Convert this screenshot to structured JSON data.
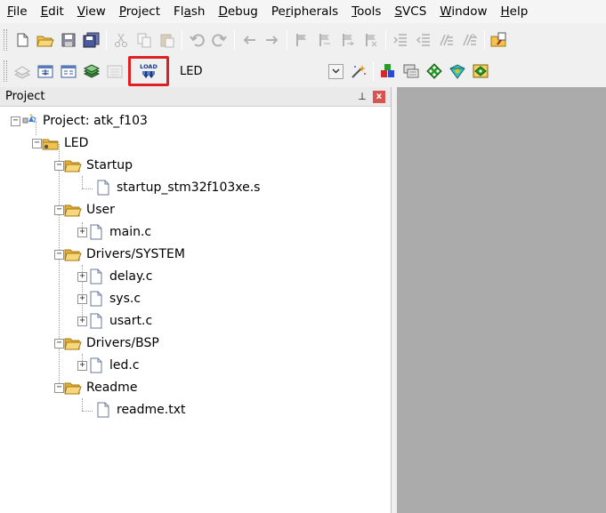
{
  "menu": {
    "items": [
      {
        "pre": "",
        "ul": "F",
        "post": "ile"
      },
      {
        "pre": "",
        "ul": "E",
        "post": "dit"
      },
      {
        "pre": "",
        "ul": "V",
        "post": "iew"
      },
      {
        "pre": "",
        "ul": "P",
        "post": "roject"
      },
      {
        "pre": "Fl",
        "ul": "a",
        "post": "sh"
      },
      {
        "pre": "",
        "ul": "D",
        "post": "ebug"
      },
      {
        "pre": "Pe",
        "ul": "r",
        "post": "ipherals"
      },
      {
        "pre": "",
        "ul": "T",
        "post": "ools"
      },
      {
        "pre": "",
        "ul": "S",
        "post": "VCS"
      },
      {
        "pre": "",
        "ul": "W",
        "post": "indow"
      },
      {
        "pre": "",
        "ul": "H",
        "post": "elp"
      }
    ]
  },
  "toolbar": {
    "load_label": "LOAD",
    "target_value": "LED"
  },
  "colors": {
    "highlight": "#e02020",
    "right_area": "#ababab",
    "folder": "#f2c14e"
  },
  "panel": {
    "title": "Project",
    "pin_glyph": "⊥",
    "close_glyph": "x"
  },
  "tree": {
    "project": "Project: atk_f103",
    "target": "LED",
    "groups": [
      {
        "name": "Startup",
        "files": [
          {
            "name": "startup_stm32f103xe.s",
            "expandable": false
          }
        ]
      },
      {
        "name": "User",
        "files": [
          {
            "name": "main.c",
            "expandable": true
          }
        ]
      },
      {
        "name": "Drivers/SYSTEM",
        "files": [
          {
            "name": "delay.c",
            "expandable": true
          },
          {
            "name": "sys.c",
            "expandable": true
          },
          {
            "name": "usart.c",
            "expandable": true
          }
        ]
      },
      {
        "name": "Drivers/BSP",
        "files": [
          {
            "name": "led.c",
            "expandable": true
          }
        ]
      },
      {
        "name": "Readme",
        "files": [
          {
            "name": "readme.txt",
            "expandable": false
          }
        ]
      }
    ]
  }
}
